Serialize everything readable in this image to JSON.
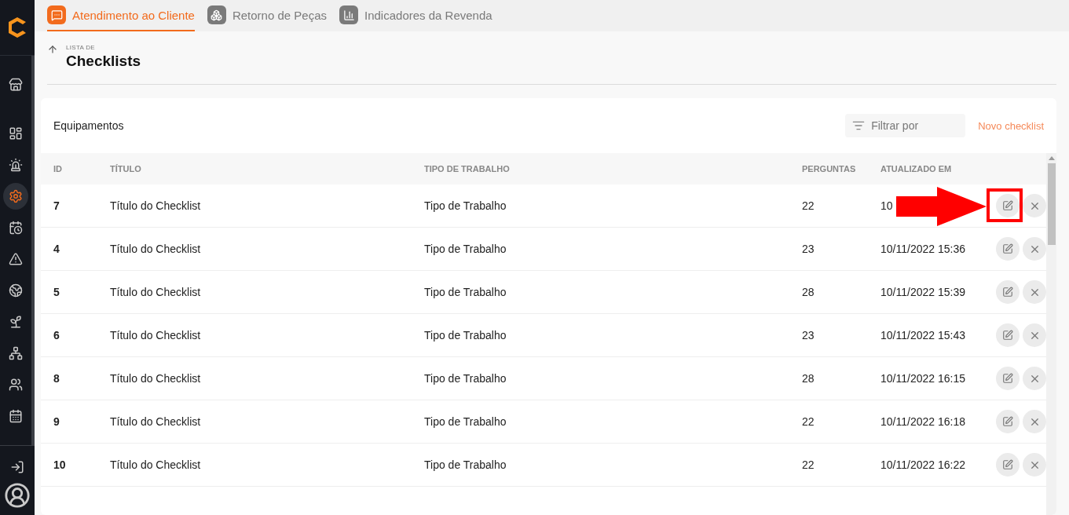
{
  "sidebar": {
    "items": [
      {
        "selected": false
      },
      {
        "selected": false
      },
      {
        "selected": false
      },
      {
        "selected": true
      },
      {
        "selected": false
      },
      {
        "selected": false
      },
      {
        "selected": false
      },
      {
        "selected": false
      },
      {
        "selected": false
      },
      {
        "selected": false
      },
      {
        "selected": false
      }
    ]
  },
  "tabs": [
    {
      "label": "Atendimento ao Cliente",
      "selected": true
    },
    {
      "label": "Retorno de Peças",
      "selected": false
    },
    {
      "label": "Indicadores da Revenda",
      "selected": false
    }
  ],
  "header": {
    "overline": "LISTA DE",
    "title": "Checklists"
  },
  "card": {
    "title": "Equipamentos",
    "filter": {
      "placeholder": "Filtrar por"
    },
    "new_button": "Novo checklist"
  },
  "table": {
    "columns": [
      "ID",
      "TÍTULO",
      "TIPO DE TRABALHO",
      "PERGUNTAS",
      "ATUALIZADO EM"
    ],
    "rows": [
      {
        "id": "7",
        "title": "Título do Checklist",
        "type": "Tipo de Trabalho",
        "questions": "22",
        "updated": "10",
        "highlighted": true
      },
      {
        "id": "4",
        "title": "Título do Checklist",
        "type": "Tipo de Trabalho",
        "questions": "23",
        "updated": "10/11/2022 15:36",
        "highlighted": false
      },
      {
        "id": "5",
        "title": "Título do Checklist",
        "type": "Tipo de Trabalho",
        "questions": "28",
        "updated": "10/11/2022 15:39",
        "highlighted": false
      },
      {
        "id": "6",
        "title": "Título do Checklist",
        "type": "Tipo de Trabalho",
        "questions": "23",
        "updated": "10/11/2022 15:43",
        "highlighted": false
      },
      {
        "id": "8",
        "title": "Título do Checklist",
        "type": "Tipo de Trabalho",
        "questions": "28",
        "updated": "10/11/2022 16:15",
        "highlighted": false
      },
      {
        "id": "9",
        "title": "Título do Checklist",
        "type": "Tipo de Trabalho",
        "questions": "22",
        "updated": "10/11/2022 16:18",
        "highlighted": false
      },
      {
        "id": "10",
        "title": "Título do Checklist",
        "type": "Tipo de Trabalho",
        "questions": "22",
        "updated": "10/11/2022 16:22",
        "highlighted": false
      }
    ]
  }
}
